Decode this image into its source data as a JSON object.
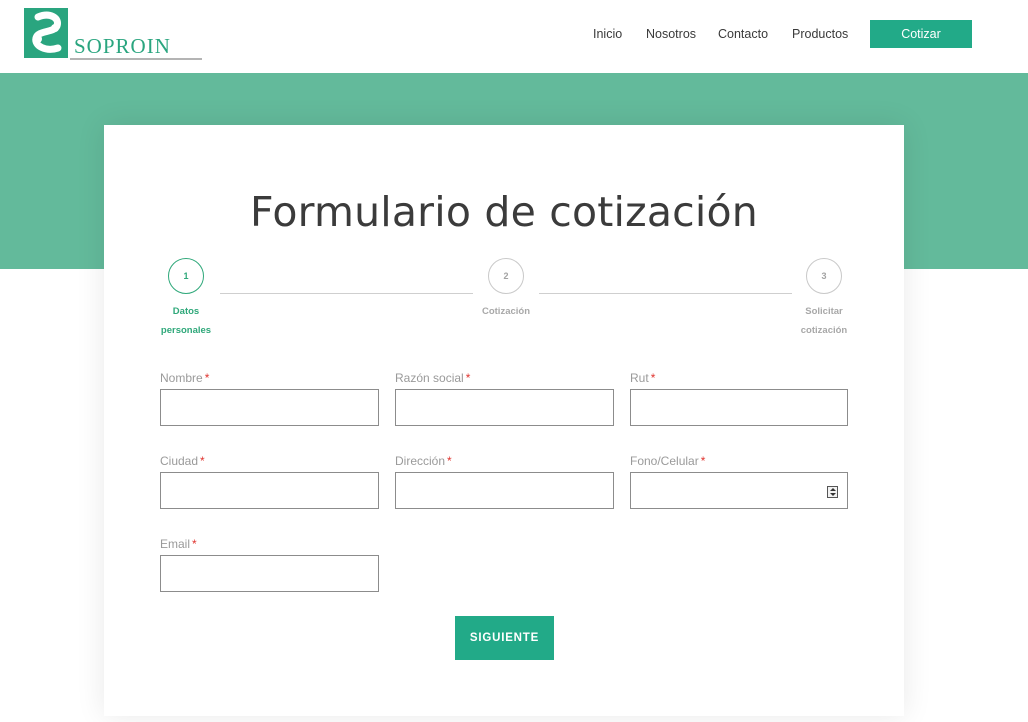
{
  "header": {
    "logo_text": "SOPROIN",
    "nav": [
      "Inicio",
      "Nosotros",
      "Contacto",
      "Productos"
    ],
    "cta_label": "Cotizar"
  },
  "form": {
    "title": "Formulario de cotización",
    "steps": [
      {
        "number": "1",
        "label_line1": "Datos",
        "label_line2": "personales",
        "active": true
      },
      {
        "number": "2",
        "label_line1": "Cotización",
        "label_line2": "",
        "active": false
      },
      {
        "number": "3",
        "label_line1": "Solicitar",
        "label_line2": "cotización",
        "active": false
      }
    ],
    "fields": {
      "nombre": {
        "label": "Nombre",
        "required_mark": "*",
        "value": ""
      },
      "razon_social": {
        "label": "Razón social",
        "required_mark": "*",
        "value": ""
      },
      "rut": {
        "label": "Rut",
        "required_mark": "*",
        "value": ""
      },
      "ciudad": {
        "label": "Ciudad",
        "required_mark": "*",
        "value": ""
      },
      "direccion": {
        "label": "Dirección",
        "required_mark": "*",
        "value": ""
      },
      "fono": {
        "label": "Fono/Celular",
        "required_mark": "*",
        "value": ""
      },
      "email": {
        "label": "Email",
        "required_mark": "*",
        "value": ""
      }
    },
    "submit_label": "SIGUIENTE"
  },
  "colors": {
    "accent": "#22aa88",
    "band": "#63ba9b",
    "active_step": "#2fa87a",
    "required": "#e0342f"
  }
}
